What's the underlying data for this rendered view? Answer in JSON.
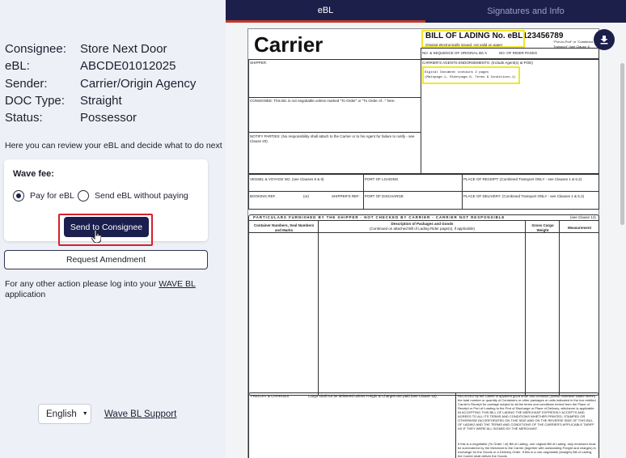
{
  "info": [
    {
      "label": "Consignee:",
      "value": "Store Next Door"
    },
    {
      "label": "eBL:",
      "value": "ABCDE01012025"
    },
    {
      "label": "Sender:",
      "value": "Carrier/Origin Agency"
    },
    {
      "label": "DOC Type:",
      "value": "Straight"
    },
    {
      "label": "Status:",
      "value": "Possessor"
    }
  ],
  "intro": "Here you can review your eBL and decide what to do next",
  "wave_fee": {
    "title": "Wave fee:",
    "option_pay": "Pay for eBL",
    "option_send": "Send eBL without paying",
    "selected": "Pay for eBL"
  },
  "buttons": {
    "send": "Send to Consignee",
    "amend": "Request Amendment"
  },
  "other_action": {
    "prefix": "For any other action please log into your ",
    "link": "WAVE BL",
    "suffix": " application"
  },
  "footer": {
    "language": "English",
    "support": "Wave BL Support"
  },
  "tabs": [
    "eBL",
    "Signatures and Info"
  ],
  "document": {
    "carrier": "Carrier",
    "bol_title": "BILL OF LADING No. eBL123456789",
    "bol_sub": "Original electronically issued, not valid on paper",
    "port_note": "\"Port-to-Port\" or \"Combined Transport\" (see Clause 1)",
    "shipper": "SHIPPER:",
    "no_seq": "NO. & SEQUENCE OF ORIGINAL B/L's",
    "rider": "NO. OF RIDER PAGES",
    "agents": "CARRIER'S AGENTS ENDORSEMENTS: (Include Agent(s) at POD)",
    "digital1": "Digital Document contains 2 pages",
    "digital2": "(Mainpage-1, Riderpage-0, Terms & Conditions-1)",
    "consignee": "CONSIGNEE: This B/L is not negotiable unless marked \"To Order\" or \"To Order of...\" here.",
    "notify": "NOTIFY PARTIES: (No responsibility shall attach to the Carrier or to his Agent for failure to notify - see Clause 20)",
    "vessel": "VESSEL & VOYAGE NO. (see Clauses 8 & 9)",
    "pol": "PORT OF LOADING",
    "receipt": "PLACE OF RECEIPT: (Combined Transport ONLY - see Clauses 1 & 5.2)",
    "booking": "BOOKING REF.",
    "or": "(or)",
    "shippers_ref": "SHIPPER'S REF.",
    "pod": "PORT OF DISCHARGE",
    "delivery": "PLACE OF DELIVERY: (Combined Transport ONLY - see Clauses 1 & 5.2)",
    "particulars": "PARTICULARS FURNISHED BY THE SHIPPER - NOT CHECKED BY CARRIER - CARRIER NOT RESPONSIBLE",
    "particulars_note": "(see Clause 14)",
    "col_container": "Container Numbers, Seal Numbers and Marks",
    "col_desc": "Description of Packages and Goods",
    "col_desc_note": "(Continued on attached Bill of Lading Rider page(s), if applicable)",
    "col_weight": "Gross Cargo Weight",
    "col_measure": "Measurement",
    "freight": "FREIGHT & CHARGES",
    "freight_note": "Cargo shall not be delivered unless Freight & Charges are paid (see Clause 16).",
    "received": "RECEIVED by the Carrier in apparent good order and condition (unless otherwise stated herein) the total number or quantity of Containers or other packages or units indicated in the box entitled Carrier's Receipt for carriage subject to all the terms and conditions hereof from the Place of Receipt or Port of Loading to the Port of Discharge or Place of Delivery, whichever is applicable. IN ACCEPTING THIS BILL OF LADING THE MERCHANT EXPRESSLY ACCEPTS AND AGREES TO ALL ITS TERMS AND CONDITIONS WHETHER PRINTED, STAMPED OR OTHERWISE INCORPORATED ON THIS SIDE AND ON THE REVERSE SIDE OF THIS BILL OF LADING AND THE TERMS AND CONDITIONS OF THE CARRIER'S APPLICABLE TARIFF AS IF THEY WERE ALL SIGNED BY THE MERCHANT.",
    "negotiable": "If this is a negotiable (To Order / of) Bill of Lading, one original Bill of Lading, duly endorsed must be surrendered by the Merchant to the Carrier (together with outstanding Freight and charges) in exchange for the Goods or a Delivery Order. If this is a non-negotiable (straight) Bill of Lading, the Carrier shall deliver the Goods"
  }
}
